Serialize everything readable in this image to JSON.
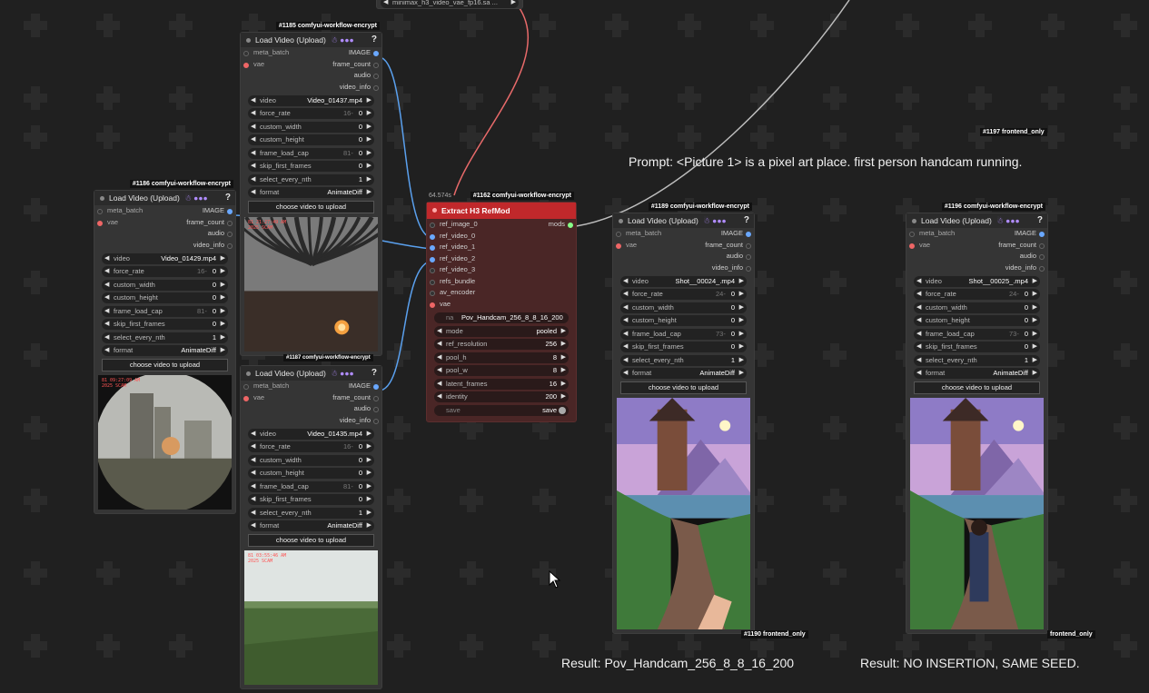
{
  "top_node": {
    "label": "minimax_h3_video_vae_fp16.sa ..."
  },
  "prompt": {
    "text": "Prompt: <Picture 1> is a pixel art place. first person handcam running."
  },
  "results": {
    "left": "Result: Pov_Handcam_256_8_8_16_200",
    "right": "Result: NO INSERTION, SAME SEED."
  },
  "tags": {
    "t1197": "#1197 frontend_only",
    "t1190": "#1190 frontend_only",
    "t_right_fe": "frontend_only",
    "t1187": "#1187 comfyui-workflow-encrypt"
  },
  "load_nodes": [
    {
      "id": "#1185 comfyui-workflow-encrypt",
      "title": "Load Video (Upload)",
      "badge": "☃ ●●●",
      "q": "?",
      "inputs": [
        "meta_batch",
        "vae"
      ],
      "outputs": [
        "IMAGE",
        "frame_count",
        "audio",
        "video_info"
      ],
      "video": "Video_01437.mp4",
      "force_rate": "0",
      "force_rate_hint": "16-",
      "custom_width": "0",
      "custom_height": "0",
      "frame_load_cap": "0",
      "frame_load_cap_hint": "81-",
      "skip_first_frames": "0",
      "select_every_nth": "1",
      "format": "AnimateDiff",
      "upload": "choose video to upload",
      "stamp": "81 21:27:49 AM\n2025 SCAM"
    },
    {
      "id": "#1186 comfyui-workflow-encrypt",
      "title": "Load Video (Upload)",
      "badge": "☃ ●●●",
      "q": "?",
      "inputs": [
        "meta_batch",
        "vae"
      ],
      "outputs": [
        "IMAGE",
        "frame_count",
        "audio",
        "video_info"
      ],
      "video": "Video_01429.mp4",
      "force_rate": "0",
      "force_rate_hint": "16-",
      "custom_width": "0",
      "custom_height": "0",
      "frame_load_cap": "0",
      "frame_load_cap_hint": "81-",
      "skip_first_frames": "0",
      "select_every_nth": "1",
      "format": "AnimateDiff",
      "upload": "choose video to upload",
      "stamp": "81 09:27:09 AM\n2025 SCAM"
    },
    {
      "id": "",
      "title": "Load Video (Upload)",
      "badge": "☃ ●●●",
      "q": "?",
      "inputs": [
        "meta_batch",
        "vae"
      ],
      "outputs": [
        "IMAGE",
        "frame_count",
        "audio",
        "video_info"
      ],
      "video": "Video_01435.mp4",
      "force_rate": "0",
      "force_rate_hint": "16-",
      "custom_width": "0",
      "custom_height": "0",
      "frame_load_cap": "0",
      "frame_load_cap_hint": "81-",
      "skip_first_frames": "0",
      "select_every_nth": "1",
      "format": "AnimateDiff",
      "upload": "choose video to upload",
      "stamp": "81 03:55:46 AM\n2025 SCAM"
    },
    {
      "id": "#1189 comfyui-workflow-encrypt",
      "title": "Load Video (Upload)",
      "badge": "☃ ●●●",
      "q": "?",
      "inputs": [
        "meta_batch",
        "vae"
      ],
      "outputs": [
        "IMAGE",
        "frame_count",
        "audio",
        "video_info"
      ],
      "video": "Shot__00024_.mp4",
      "force_rate": "0",
      "force_rate_hint": "24-",
      "custom_width": "0",
      "custom_height": "0",
      "frame_load_cap": "0",
      "frame_load_cap_hint": "73-",
      "skip_first_frames": "0",
      "select_every_nth": "1",
      "format": "AnimateDiff",
      "upload": "choose video to upload",
      "stamp": ""
    },
    {
      "id": "#1196 comfyui-workflow-encrypt",
      "title": "Load Video (Upload)",
      "badge": "☃ ●●●",
      "q": "?",
      "inputs": [
        "meta_batch",
        "vae"
      ],
      "outputs": [
        "IMAGE",
        "frame_count",
        "audio",
        "video_info"
      ],
      "video": "Shot__00025_.mp4",
      "force_rate": "0",
      "force_rate_hint": "24-",
      "custom_width": "0",
      "custom_height": "0",
      "frame_load_cap": "0",
      "frame_load_cap_hint": "73-",
      "skip_first_frames": "0",
      "select_every_nth": "1",
      "format": "AnimateDiff",
      "upload": "choose video to upload",
      "stamp": ""
    }
  ],
  "widget_labels": {
    "video": "video",
    "force_rate": "force_rate",
    "custom_width": "custom_width",
    "custom_height": "custom_height",
    "frame_load_cap": "frame_load_cap",
    "skip_first_frames": "skip_first_frames",
    "select_every_nth": "select_every_nth",
    "format": "format"
  },
  "refmod": {
    "id": "#1162 comfyui-workflow-encrypt",
    "time": "64.574s",
    "title": "Extract H3 RefMod",
    "inputs": [
      "ref_image_0",
      "ref_video_0",
      "ref_video_1",
      "ref_video_2",
      "ref_video_3",
      "refs_bundle",
      "av_encoder",
      "vae"
    ],
    "output": "mods",
    "widgets": [
      {
        "label": "na",
        "value": "Pov_Handcam_256_8_8_16_200"
      },
      {
        "label": "mode",
        "value": "pooled"
      },
      {
        "label": "ref_resolution",
        "value": "256"
      },
      {
        "label": "pool_h",
        "value": "8"
      },
      {
        "label": "pool_w",
        "value": "8"
      },
      {
        "label": "latent_frames",
        "value": "16"
      },
      {
        "label": "identity",
        "value": "200"
      }
    ],
    "save_label": "save",
    "save_value": "save"
  },
  "colors": {
    "canvas": "#202020",
    "node": "#353535",
    "refmod_header": "#c0282b",
    "wire_blue": "#5aa0ee",
    "wire_red": "#e86a6a",
    "wire_gray": "#bdbdbd"
  }
}
